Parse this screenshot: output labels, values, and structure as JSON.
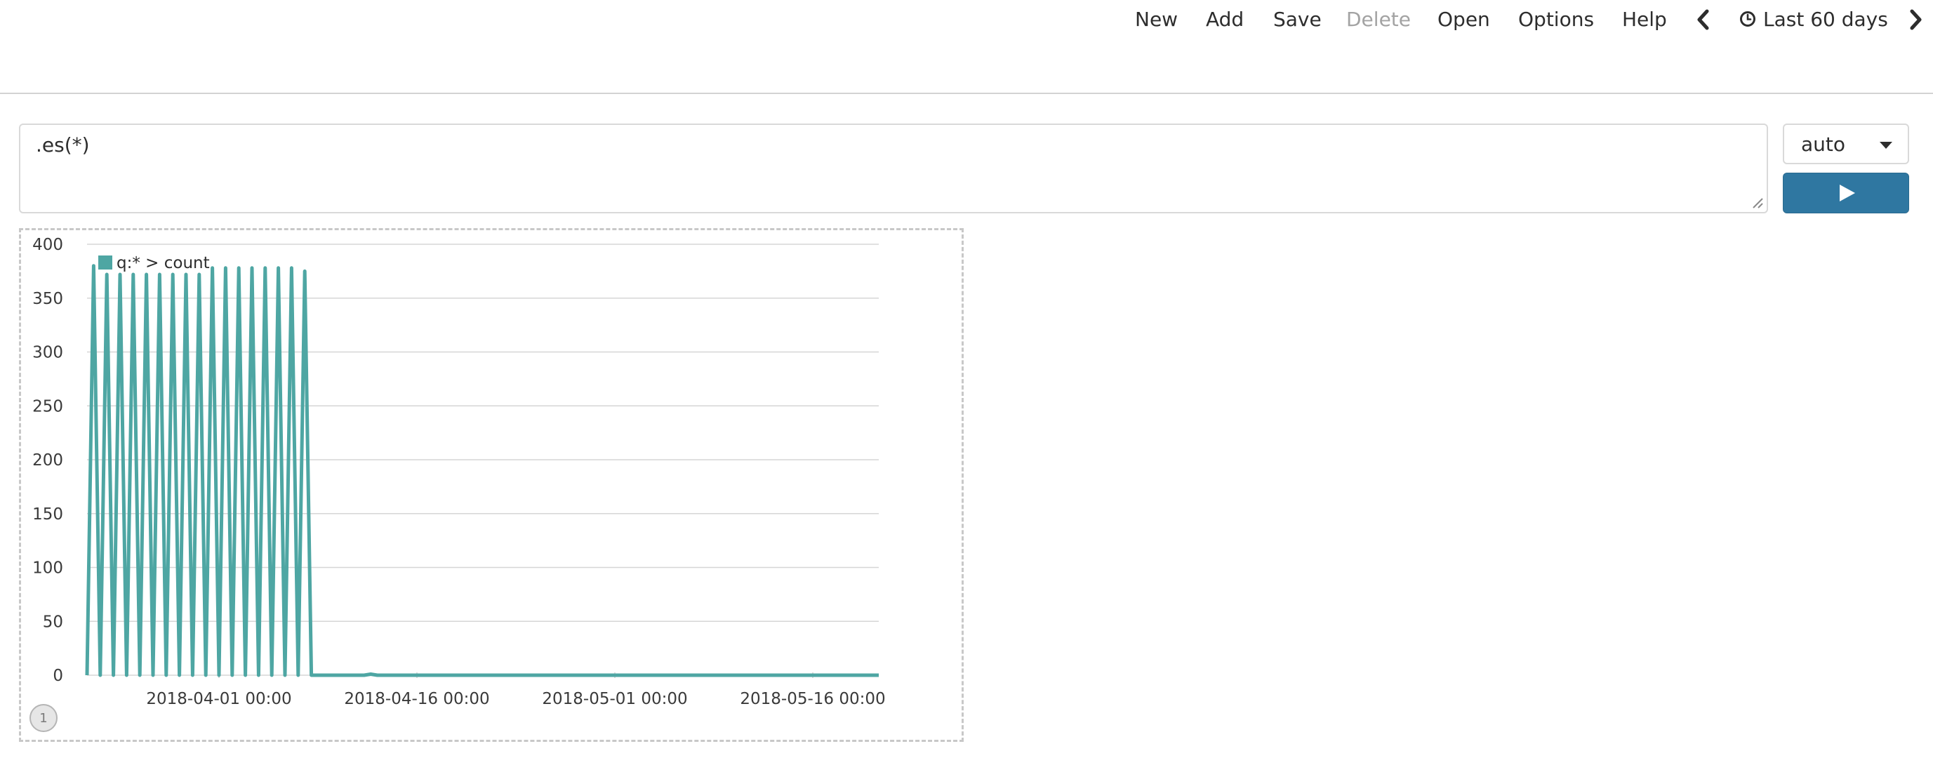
{
  "toolbar": {
    "new_label": "New",
    "add_label": "Add",
    "save_label": "Save",
    "delete_label": "Delete",
    "open_label": "Open",
    "options_label": "Options",
    "help_label": "Help",
    "time_range_label": "Last 60 days"
  },
  "expression": {
    "value": ".es(*)"
  },
  "interval": {
    "selected": "auto"
  },
  "panel": {
    "badge": "1"
  },
  "colors": {
    "series": "#4ea6a3",
    "run_button": "#2f77a1",
    "gridline": "#d6d6d6"
  },
  "chart_data": {
    "type": "line",
    "x_axis_type": "date",
    "x_range": [
      "2018-03-22",
      "2018-05-21"
    ],
    "ylim": [
      0,
      400
    ],
    "y_ticks": [
      0,
      50,
      100,
      150,
      200,
      250,
      300,
      350,
      400
    ],
    "x_tick_labels": [
      {
        "date": "2018-04-01",
        "label": "2018-04-01 00:00"
      },
      {
        "date": "2018-04-16",
        "label": "2018-04-16 00:00"
      },
      {
        "date": "2018-05-01",
        "label": "2018-05-01 00:00"
      },
      {
        "date": "2018-05-16",
        "label": "2018-05-16 00:00"
      }
    ],
    "grid": true,
    "legend": "top-left",
    "series": [
      {
        "name": "q:* > count",
        "points": [
          [
            "2018-03-22T00:00",
            0
          ],
          [
            "2018-03-22T12:00",
            380
          ],
          [
            "2018-03-23T00:00",
            0
          ],
          [
            "2018-03-23T12:00",
            372
          ],
          [
            "2018-03-24T00:00",
            0
          ],
          [
            "2018-03-24T12:00",
            372
          ],
          [
            "2018-03-25T00:00",
            0
          ],
          [
            "2018-03-25T12:00",
            372
          ],
          [
            "2018-03-26T00:00",
            0
          ],
          [
            "2018-03-26T12:00",
            372
          ],
          [
            "2018-03-27T00:00",
            0
          ],
          [
            "2018-03-27T12:00",
            372
          ],
          [
            "2018-03-28T00:00",
            0
          ],
          [
            "2018-03-28T12:00",
            372
          ],
          [
            "2018-03-29T00:00",
            0
          ],
          [
            "2018-03-29T12:00",
            372
          ],
          [
            "2018-03-30T00:00",
            0
          ],
          [
            "2018-03-30T12:00",
            372
          ],
          [
            "2018-03-31T00:00",
            0
          ],
          [
            "2018-03-31T12:00",
            378
          ],
          [
            "2018-04-01T00:00",
            0
          ],
          [
            "2018-04-01T12:00",
            378
          ],
          [
            "2018-04-02T00:00",
            0
          ],
          [
            "2018-04-02T12:00",
            378
          ],
          [
            "2018-04-03T00:00",
            0
          ],
          [
            "2018-04-03T12:00",
            378
          ],
          [
            "2018-04-04T00:00",
            0
          ],
          [
            "2018-04-04T12:00",
            378
          ],
          [
            "2018-04-05T00:00",
            0
          ],
          [
            "2018-04-05T12:00",
            378
          ],
          [
            "2018-04-06T00:00",
            0
          ],
          [
            "2018-04-06T12:00",
            378
          ],
          [
            "2018-04-07T00:00",
            0
          ],
          [
            "2018-04-07T12:00",
            375
          ],
          [
            "2018-04-08T00:00",
            0
          ],
          [
            "2018-04-12T00:00",
            0
          ],
          [
            "2018-04-12T12:00",
            1
          ],
          [
            "2018-04-13T00:00",
            0
          ],
          [
            "2018-05-21T00:00",
            0
          ]
        ]
      }
    ]
  }
}
